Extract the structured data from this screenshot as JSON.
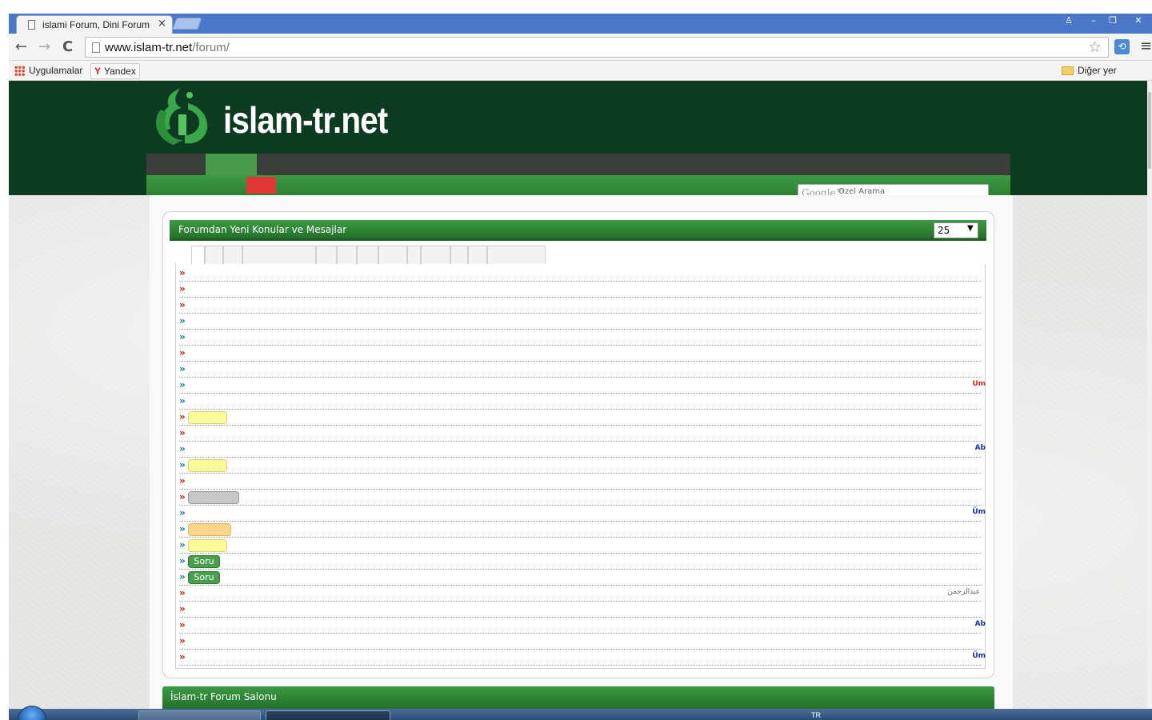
{
  "browser": {
    "tab_title": "islami Forum, Dini Forum, ",
    "tab_close": "×",
    "url_domain": "www.islam-tr.net",
    "url_path": "/forum/",
    "back": "←",
    "forward": "→",
    "reload": "C",
    "star": "☆",
    "menu": "≡",
    "ext": "⟲",
    "window_controls": {
      "user": "♙",
      "minimize": "–",
      "maximize": "❐",
      "close": "✕"
    },
    "bookmarks": {
      "apps": "Uygulamalar",
      "yandex_mark": "Y",
      "yandex": "Yandex",
      "other": "Diğer yer işaretleri"
    }
  },
  "site": {
    "brand": "islam-tr.net",
    "search_brand": "Google™",
    "search_placeholder": "Özel Arama"
  },
  "panel": {
    "title": "Forumdan Yeni Konular ve Mesajlar",
    "per_page": "25",
    "per_page_options": [
      "25"
    ],
    "rows": [
      {
        "bullet": "»",
        "color": "red"
      },
      {
        "bullet": "»",
        "color": "red"
      },
      {
        "bullet": "»",
        "color": "red"
      },
      {
        "bullet": "»",
        "color": "teal"
      },
      {
        "bullet": "»",
        "color": "teal"
      },
      {
        "bullet": "»",
        "color": "red"
      },
      {
        "bullet": "»",
        "color": "teal"
      },
      {
        "bullet": "»",
        "color": "teal",
        "right": "Um",
        "right_color": "red"
      },
      {
        "bullet": "»",
        "color": "teal"
      },
      {
        "bullet": "»",
        "color": "red",
        "badge": "",
        "badge_color": "yellow"
      },
      {
        "bullet": "»",
        "color": "red"
      },
      {
        "bullet": "»",
        "color": "teal",
        "right": "Ab",
        "right_color": "blue"
      },
      {
        "bullet": "»",
        "color": "teal",
        "badge": "",
        "badge_color": "yellow"
      },
      {
        "bullet": "»",
        "color": "red"
      },
      {
        "bullet": "»",
        "color": "red",
        "badge": "",
        "badge_color": "grey"
      },
      {
        "bullet": "»",
        "color": "teal",
        "right": "Üm",
        "right_color": "blue"
      },
      {
        "bullet": "»",
        "color": "teal",
        "badge": "",
        "badge_color": "orange"
      },
      {
        "bullet": "»",
        "color": "teal",
        "badge": "",
        "badge_color": "yellow"
      },
      {
        "bullet": "»",
        "color": "teal",
        "badge": "Soru",
        "badge_color": "green"
      },
      {
        "bullet": "»",
        "color": "teal",
        "badge": "Soru",
        "badge_color": "green"
      },
      {
        "bullet": "»",
        "color": "red",
        "right": "عبدالرحمن",
        "right_color": "grey"
      },
      {
        "bullet": "»",
        "color": "red"
      },
      {
        "bullet": "»",
        "color": "red",
        "right": "Ab",
        "right_color": "blue"
      },
      {
        "bullet": "»",
        "color": "red"
      },
      {
        "bullet": "»",
        "color": "red",
        "right": "Üm",
        "right_color": "blue"
      }
    ]
  },
  "section": {
    "title": "İslam-tr Forum Salonu"
  },
  "taskbar": {
    "lang": "TR"
  }
}
